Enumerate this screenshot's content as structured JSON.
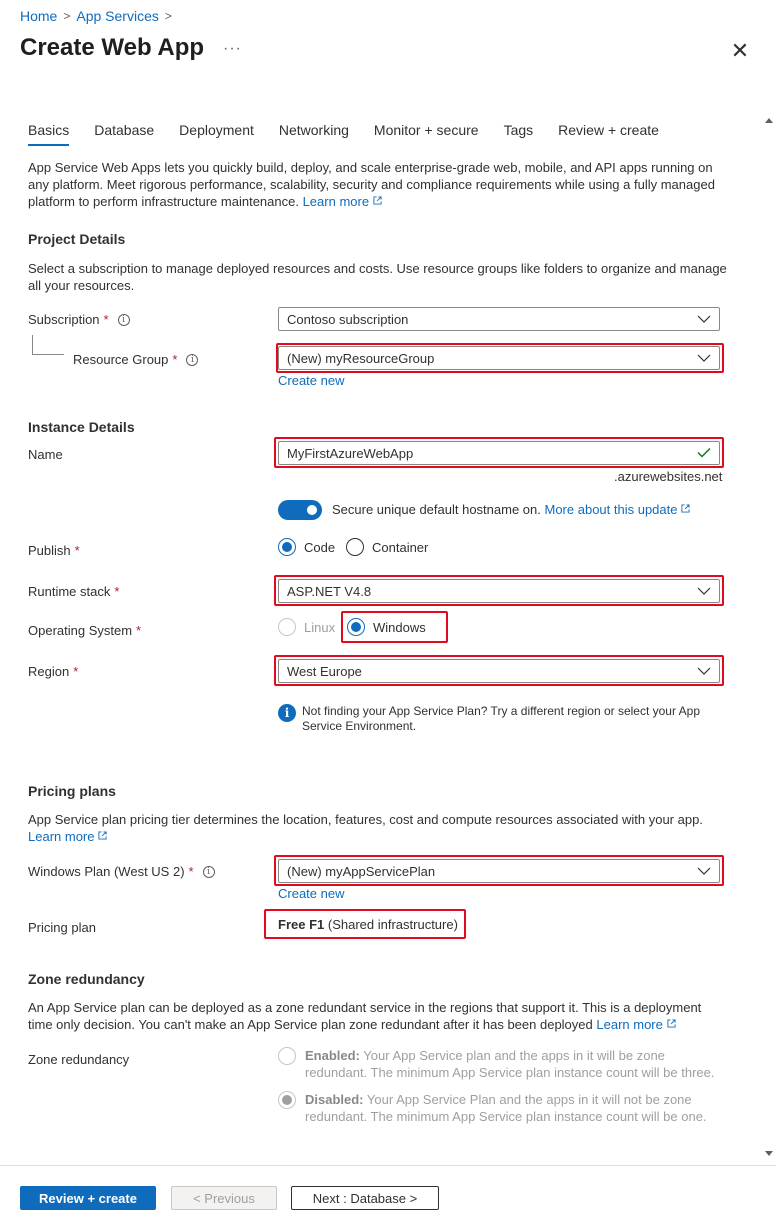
{
  "breadcrumb": {
    "home": "Home",
    "app_services": "App Services"
  },
  "page": {
    "title": "Create Web App",
    "more": "···",
    "close": "✕"
  },
  "tabs": [
    {
      "label": "Basics",
      "active": true
    },
    {
      "label": "Database"
    },
    {
      "label": "Deployment"
    },
    {
      "label": "Networking"
    },
    {
      "label": "Monitor + secure"
    },
    {
      "label": "Tags"
    },
    {
      "label": "Review + create"
    }
  ],
  "intro": {
    "text": "App Service Web Apps lets you quickly build, deploy, and scale enterprise-grade web, mobile, and API apps running on any platform. Meet rigorous performance, scalability, security and compliance requirements while using a fully managed platform to perform infrastructure maintenance.",
    "learn_more": "Learn more"
  },
  "project": {
    "heading": "Project Details",
    "description": "Select a subscription to manage deployed resources and costs. Use resource groups like folders to organize and manage all your resources.",
    "subscription_label": "Subscription",
    "subscription_value": "Contoso subscription",
    "resource_group_label": "Resource Group",
    "resource_group_value": "(New) myResourceGroup",
    "create_new": "Create new"
  },
  "instance": {
    "heading": "Instance Details",
    "name_label": "Name",
    "name_value": "MyFirstAzureWebApp",
    "name_suffix": ".azurewebsites.net",
    "secure_hostname_text": "Secure unique default hostname on.",
    "secure_hostname_link": "More about this update",
    "publish_label": "Publish",
    "publish_code": "Code",
    "publish_container": "Container",
    "runtime_label": "Runtime stack",
    "runtime_value": "ASP.NET V4.8",
    "os_label": "Operating System",
    "os_linux": "Linux",
    "os_windows": "Windows",
    "region_label": "Region",
    "region_value": "West Europe",
    "region_info": "Not finding your App Service Plan? Try a different region or select your App Service Environment."
  },
  "pricing": {
    "heading": "Pricing plans",
    "description": "App Service plan pricing tier determines the location, features, cost and compute resources associated with your app.",
    "learn_more": "Learn more",
    "plan_label": "Windows Plan (West US 2)",
    "plan_value": "(New) myAppServicePlan",
    "create_new": "Create new",
    "pricing_label": "Pricing plan",
    "pricing_tier": "Free F1",
    "pricing_detail": "(Shared infrastructure)"
  },
  "zone": {
    "heading": "Zone redundancy",
    "description": "An App Service plan can be deployed as a zone redundant service in the regions that support it. This is a deployment time only decision. You can't make an App Service plan zone redundant after it has been deployed",
    "learn_more": "Learn more",
    "label": "Zone redundancy",
    "enabled_title": "Enabled:",
    "enabled_text": "Your App Service plan and the apps in it will be zone redundant. The minimum App Service plan instance count will be three.",
    "disabled_title": "Disabled:",
    "disabled_text": "Your App Service Plan and the apps in it will not be zone redundant. The minimum App Service plan instance count will be one."
  },
  "footer": {
    "review_create": "Review + create",
    "previous": "< Previous",
    "next": "Next : Database >"
  },
  "colors": {
    "accent": "#0f6cbd",
    "highlight": "#e00b1c",
    "required": "#a4262c"
  }
}
